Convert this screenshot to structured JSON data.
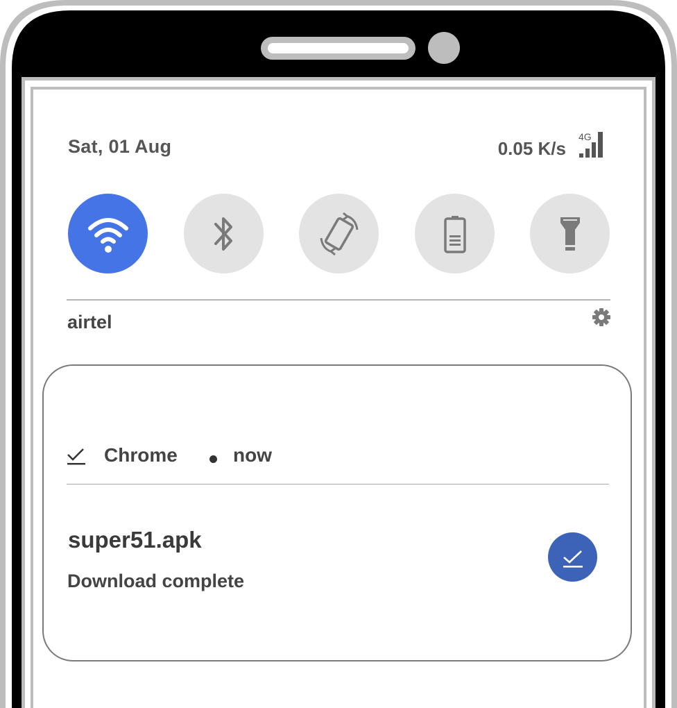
{
  "status_bar": {
    "date": "Sat, 01 Aug",
    "network_speed": "0.05 K/s",
    "network_type": "4G",
    "signal_icon": "signal-bars-icon"
  },
  "quick_settings": [
    {
      "name": "wifi",
      "icon": "wifi-icon",
      "active": true
    },
    {
      "name": "bluetooth",
      "icon": "bluetooth-icon",
      "active": false
    },
    {
      "name": "auto-rotate",
      "icon": "rotate-icon",
      "active": false
    },
    {
      "name": "battery-saver",
      "icon": "battery-icon",
      "active": false
    },
    {
      "name": "flashlight",
      "icon": "flashlight-icon",
      "active": false
    }
  ],
  "carrier": {
    "name": "airtel",
    "settings_icon": "gear-icon"
  },
  "notification": {
    "app_icon": "download-check-icon",
    "app_name": "Chrome",
    "time": "now",
    "title": "super51.apk",
    "body": "Download complete",
    "action_icon": "download-check-icon"
  },
  "colors": {
    "active_tile": "#4474e6",
    "inactive_tile": "#e3e3e3",
    "action_button": "#3d63b8",
    "frame_gray": "#bdbdbd",
    "bezel_black": "#000000"
  }
}
